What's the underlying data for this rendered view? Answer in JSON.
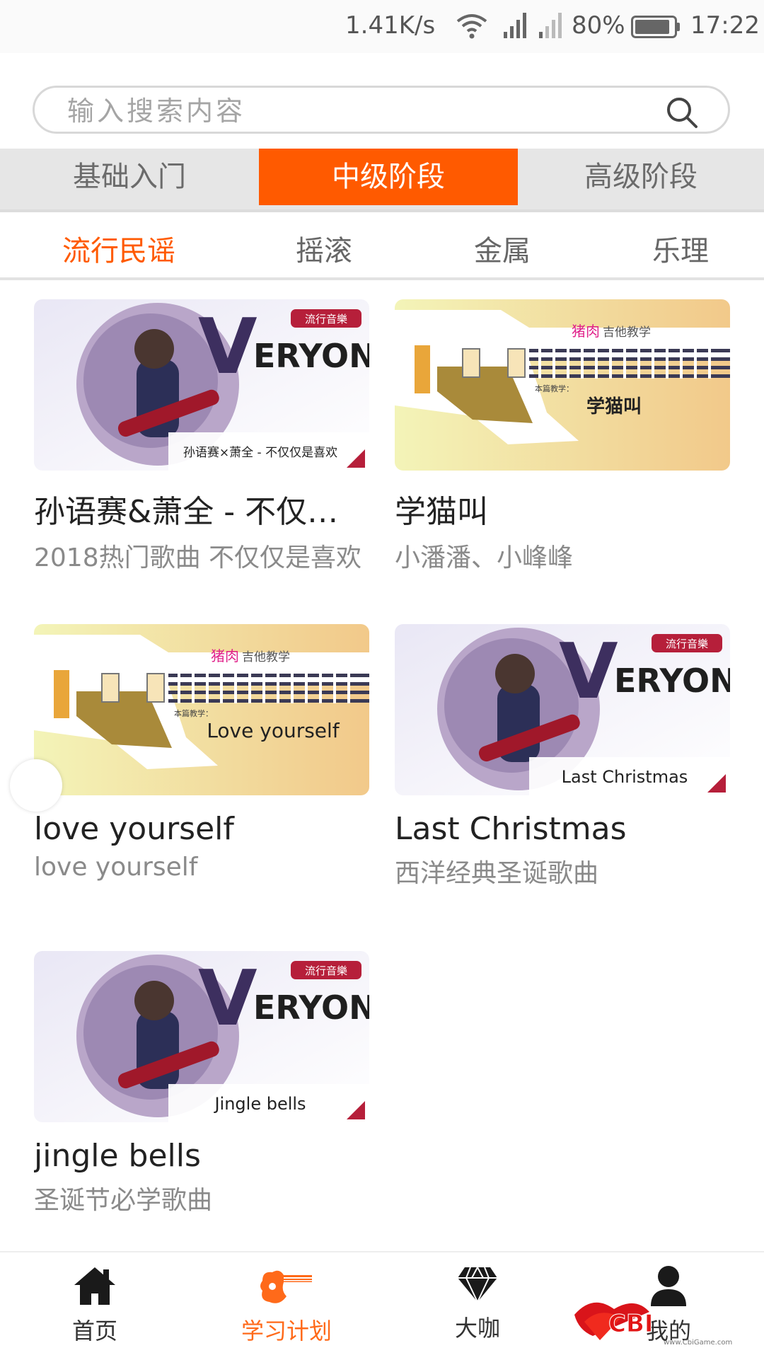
{
  "status_bar": {
    "speed": "1.41K/s",
    "battery": "80%",
    "time": "17:22"
  },
  "search": {
    "placeholder": "输入搜索内容"
  },
  "level_tabs": [
    "基础入门",
    "中级阶段",
    "高级阶段"
  ],
  "genre_tabs": [
    "流行民谣",
    "摇滚",
    "金属",
    "乐理"
  ],
  "courses": [
    {
      "title": "孙语赛&萧全 - 不仅仅是喜欢",
      "subtitle": "2018热门歌曲 不仅仅是喜欢",
      "thumb_caption": "孙语赛×萧全 - 不仅仅是喜欢",
      "badge": "流行音樂",
      "brand": "ERYON",
      "brand_initial": "V"
    },
    {
      "title": "学猫叫",
      "subtitle": "小潘潘、小峰峰",
      "thumb_caption": "学猫叫",
      "thumb_heading_highlight": "猪肉",
      "thumb_heading": "吉他教学",
      "thumb_label": "本篇教学："
    },
    {
      "title": "love yourself",
      "subtitle": "love yourself",
      "thumb_caption": "Love yourself",
      "thumb_heading_highlight": "猪肉",
      "thumb_heading": "吉他教学",
      "thumb_label": "本篇教学："
    },
    {
      "title": "Last Christmas",
      "subtitle": "西洋经典圣诞歌曲",
      "thumb_caption": "Last Christmas",
      "badge": "流行音樂",
      "brand": "ERYON",
      "brand_initial": "V"
    },
    {
      "title": "jingle bells",
      "subtitle": "圣诞节必学歌曲",
      "thumb_caption": "Jingle bells",
      "badge": "流行音樂",
      "brand": "ERYON",
      "brand_initial": "V"
    }
  ],
  "bottom_nav": [
    {
      "label": "首页",
      "icon": "home-icon"
    },
    {
      "label": "学习计划",
      "icon": "guitar-icon"
    },
    {
      "label": "大咖",
      "icon": "diamond-icon"
    },
    {
      "label": "我的",
      "icon": "person-icon"
    }
  ],
  "watermark": {
    "logo": "CBI",
    "url": "www.CbiGame.com"
  },
  "colors": {
    "accent": "#ff5a00",
    "tab_bg": "#e6e6e6",
    "text_secondary": "#8a8a8a"
  }
}
